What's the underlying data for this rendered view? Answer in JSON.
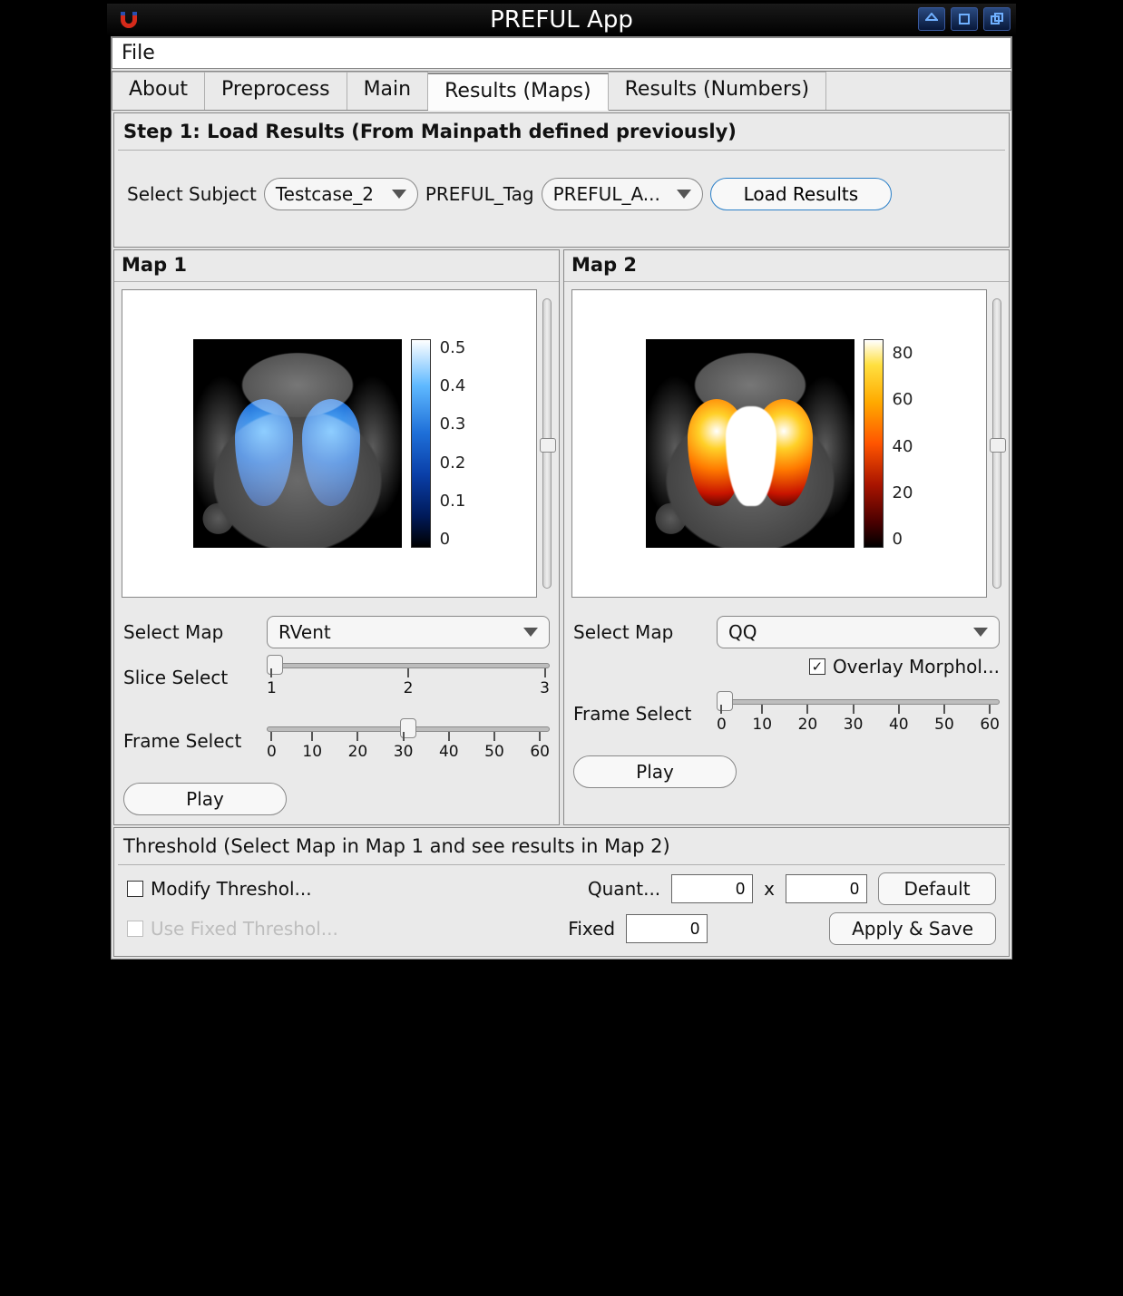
{
  "window": {
    "title": "PREFUL App",
    "icon_name": "magnet-icon"
  },
  "menubar": {
    "file": "File"
  },
  "tabs": [
    {
      "id": "about",
      "label": "About"
    },
    {
      "id": "preproc",
      "label": "Preprocess"
    },
    {
      "id": "main",
      "label": "Main"
    },
    {
      "id": "rmaps",
      "label": "Results (Maps)",
      "active": true
    },
    {
      "id": "rnums",
      "label": "Results (Numbers)"
    }
  ],
  "step1": {
    "title": "Step 1: Load Results (From Mainpath defined previously)",
    "select_subject_label": "Select Subject",
    "select_subject_value": "Testcase_2",
    "preful_tag_label": "PREFUL_Tag",
    "preful_tag_value": "PREFUL_A...",
    "load_button": "Load Results"
  },
  "maps": {
    "map1": {
      "head": "Map 1",
      "select_map_label": "Select Map",
      "select_map_value": "RVent",
      "slice_select_label": "Slice Select",
      "slice_ticks": [
        "1",
        "2",
        "3"
      ],
      "slice_value_index": 0,
      "frame_select_label": "Frame Select",
      "frame_ticks": [
        "0",
        "10",
        "20",
        "30",
        "40",
        "50",
        "60"
      ],
      "frame_value_index": 3,
      "play": "Play",
      "colorbar_ticks": [
        "0.5",
        "0.4",
        "0.3",
        "0.2",
        "0.1",
        "0"
      ]
    },
    "map2": {
      "head": "Map 2",
      "select_map_label": "Select Map",
      "select_map_value": "QQ",
      "overlay_label": "Overlay Morphol...",
      "overlay_checked": true,
      "frame_select_label": "Frame Select",
      "frame_ticks": [
        "0",
        "10",
        "20",
        "30",
        "40",
        "50",
        "60"
      ],
      "frame_value_index": 0,
      "play": "Play",
      "colorbar_ticks": [
        "80",
        "60",
        "40",
        "20",
        "0"
      ]
    }
  },
  "threshold": {
    "title": "Threshold (Select Map in Map 1 and see results in Map 2)",
    "modify_label": "Modify Threshol...",
    "use_fixed_label": "Use Fixed Threshol...",
    "quant_label": "Quant...",
    "fixed_label": "Fixed",
    "quant_a": "0",
    "x": "x",
    "quant_b": "0",
    "fixed_val": "0",
    "default_btn": "Default",
    "apply_btn": "Apply & Save"
  },
  "chart_data": [
    {
      "type": "heatmap",
      "title": "Map 1 — RVent",
      "colormap": "blue-to-white",
      "value_range": [
        0,
        0.5
      ],
      "colorbar_ticks": [
        0,
        0.1,
        0.2,
        0.3,
        0.4,
        0.5
      ],
      "description": "Coronal chest MRI with ventilation overlay on both lungs",
      "slice": 1,
      "frame": 30
    },
    {
      "type": "heatmap",
      "title": "Map 2 — QQ",
      "colormap": "hot",
      "value_range": [
        0,
        90
      ],
      "colorbar_ticks": [
        0,
        20,
        40,
        60,
        80
      ],
      "description": "Coronal chest MRI with perfusion/QQ overlay on both lungs, bright central region",
      "overlay_morphology": true,
      "frame": 0
    }
  ]
}
